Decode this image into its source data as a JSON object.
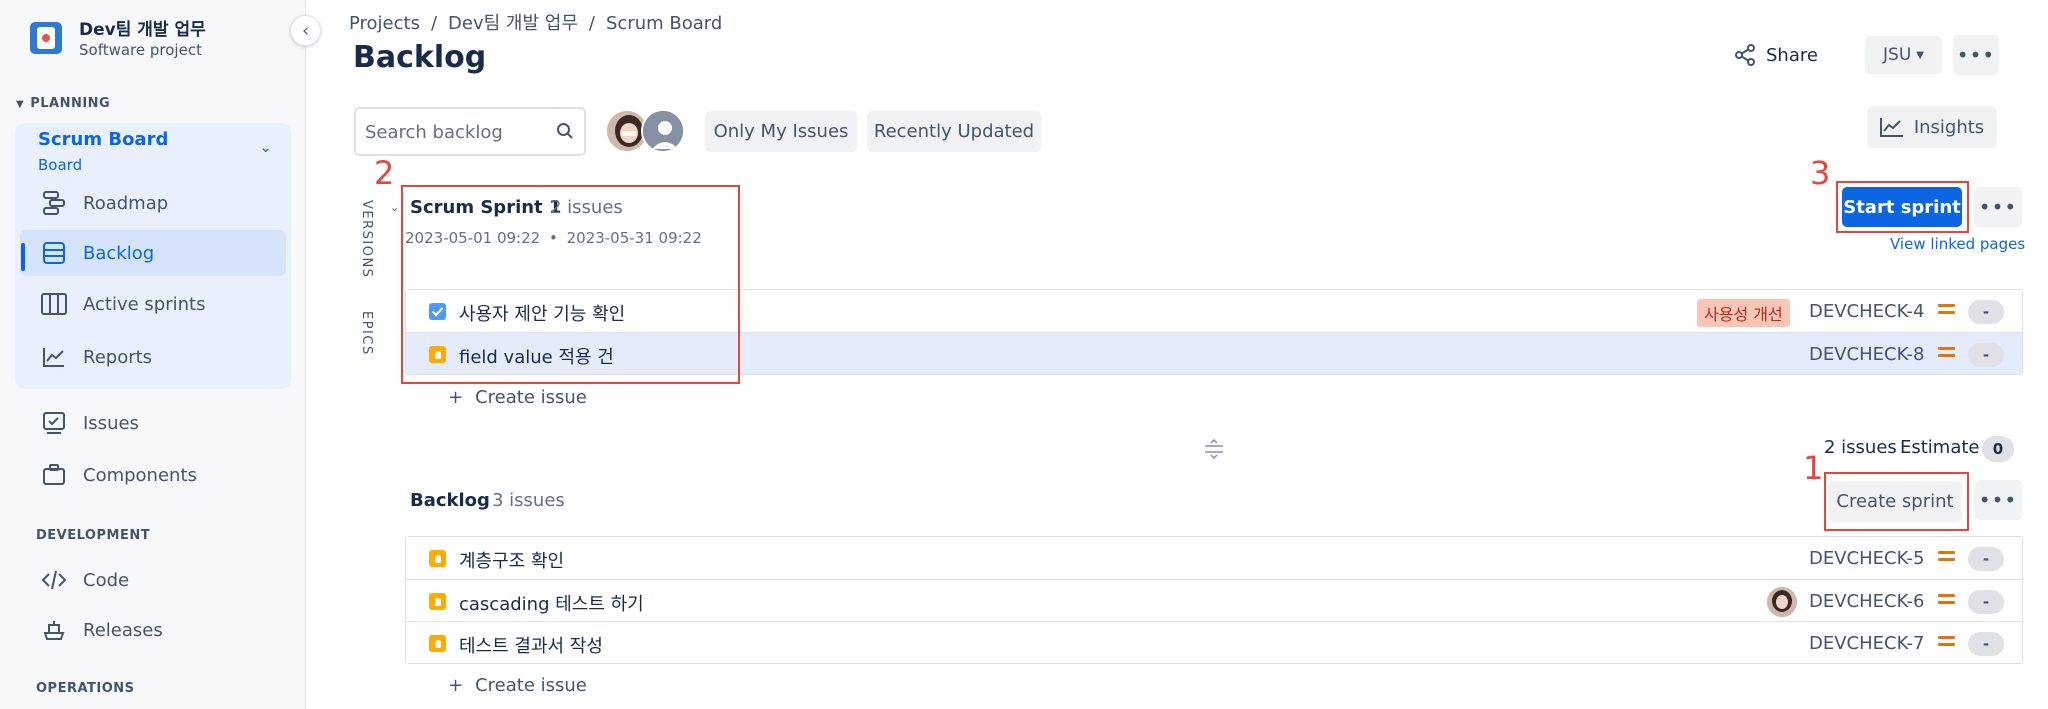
{
  "project": {
    "title": "Dev팀 개발 업무",
    "subtitle": "Software project"
  },
  "sidebar": {
    "planning_heading": "PLANNING",
    "board_card": {
      "title": "Scrum Board",
      "subtitle": "Board"
    },
    "planning_items": [
      {
        "label": "Roadmap",
        "icon": "roadmap-icon"
      },
      {
        "label": "Backlog",
        "icon": "backlog-icon",
        "active": true
      },
      {
        "label": "Active sprints",
        "icon": "board-columns-icon"
      },
      {
        "label": "Reports",
        "icon": "reports-icon"
      }
    ],
    "other_items": [
      {
        "label": "Issues",
        "icon": "issues-icon"
      },
      {
        "label": "Components",
        "icon": "components-icon"
      }
    ],
    "development_heading": "DEVELOPMENT",
    "development_items": [
      {
        "label": "Code",
        "icon": "code-icon"
      },
      {
        "label": "Releases",
        "icon": "releases-icon"
      }
    ],
    "operations_heading": "OPERATIONS"
  },
  "breadcrumb": [
    "Projects",
    "Dev팀 개발 업무",
    "Scrum Board"
  ],
  "header": {
    "title": "Backlog",
    "share_label": "Share",
    "user_menu_label": "JSU"
  },
  "toolbar": {
    "search_placeholder": "Search backlog",
    "filters": [
      "Only My Issues",
      "Recently Updated"
    ],
    "insights_label": "Insights"
  },
  "side_tabs": [
    "VERSIONS",
    "EPICS"
  ],
  "sprint": {
    "name": "Scrum Sprint 1",
    "issue_count": "2 issues",
    "start": "2023-05-01 09:22",
    "dot": "•",
    "end": "2023-05-31 09:22",
    "start_button": "Start sprint",
    "view_linked": "View linked pages",
    "issues": [
      {
        "type": "task",
        "summary": "사용자 제안 기능 확인",
        "label": "사용성 개선",
        "key": "DEVCHECK-4",
        "estimate": "-"
      },
      {
        "type": "story",
        "summary": "field value 적용 건",
        "key": "DEVCHECK-8",
        "estimate": "-",
        "selected": true
      }
    ],
    "create_issue": "Create issue"
  },
  "backlog": {
    "summary_count": "2 issues",
    "estimate_label": "Estimate",
    "estimate_value": "0",
    "name": "Backlog",
    "issue_count": "3 issues",
    "create_sprint_button": "Create sprint",
    "issues": [
      {
        "type": "story",
        "summary": "계층구조 확인",
        "key": "DEVCHECK-5",
        "estimate": "-"
      },
      {
        "type": "story",
        "summary": "cascading 테스트 하기",
        "key": "DEVCHECK-6",
        "estimate": "-",
        "assignee": true
      },
      {
        "type": "story",
        "summary": "테스트 결과서 작성",
        "key": "DEVCHECK-7",
        "estimate": "-"
      }
    ],
    "create_issue": "Create issue"
  },
  "annotations": [
    "1",
    "2",
    "3"
  ],
  "colors": {
    "accent": "#0c66e4",
    "annotation": "#e5453a",
    "priority": "#e2740b",
    "label_bg": "#f9c5b4"
  }
}
